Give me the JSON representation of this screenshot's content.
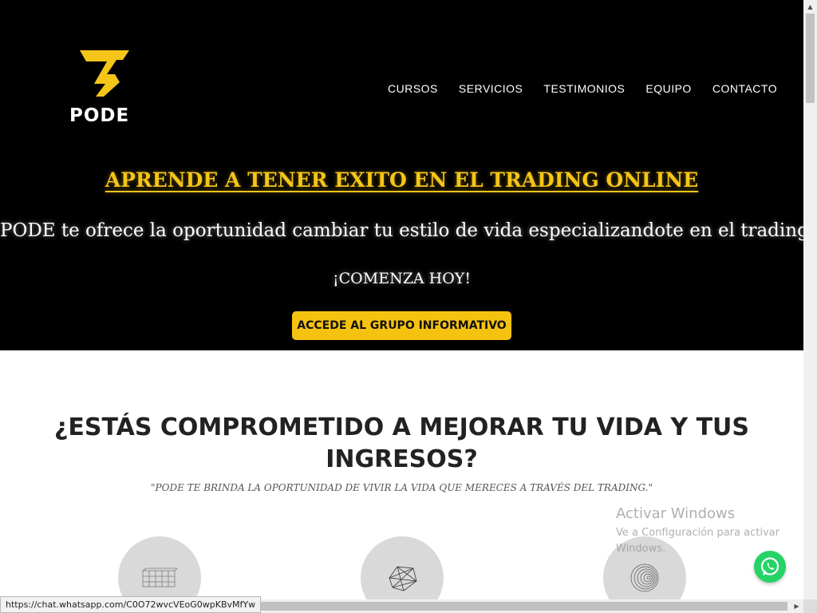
{
  "header": {
    "logo_text": "PODE",
    "nav": [
      "CURSOS",
      "SERVICIOS",
      "TESTIMONIOS",
      "EQUIPO",
      "CONTACTO"
    ]
  },
  "hero": {
    "title": "APRENDE A TENER EXITO EN EL TRADING ONLINE",
    "subtitle": "PODE te ofrece la oportunidad cambiar tu estilo de vida especializandote en el trading",
    "cta_text": "¡COMENZA HOY!",
    "button_label": "ACCEDE AL GRUPO INFORMATIVO"
  },
  "section": {
    "title": "¿ESTÁS COMPROMETIDO A MEJORAR TU VIDA Y TUS INGRESOS?",
    "quote": "\"PODE TE BRINDA LA OPORTUNIDAD DE VIVIR LA VIDA QUE MERECES A TRAVÉS DEL TRADING.\"",
    "feature_icons": [
      "grid-box-icon",
      "wireframe-shape-icon",
      "spiral-sphere-icon"
    ]
  },
  "overlay": {
    "windows_title": "Activar Windows",
    "windows_sub": "Ve a Configuración para activar Windows.",
    "status_url": "https://chat.whatsapp.com/C0O72wvcVEoG0wpKBvMfYw"
  },
  "colors": {
    "hero_bg": "#000000",
    "accent_yellow": "#f5c20f",
    "whatsapp_green": "#25d366",
    "title_text": "#222222"
  }
}
